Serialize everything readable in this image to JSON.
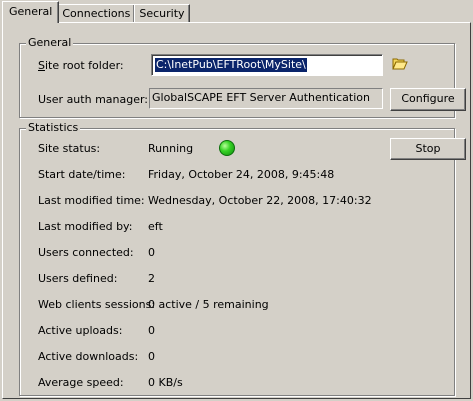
{
  "tabs": [
    {
      "label": "General",
      "active": true
    },
    {
      "label": "Connections",
      "active": false
    },
    {
      "label": "Security",
      "active": false
    }
  ],
  "general": {
    "group_title": "General",
    "site_root_label": "Site root folder:",
    "site_root_value": "C:\\InetPub\\EFTRoot\\MySite\\",
    "user_auth_label": "User auth manager:",
    "user_auth_value": "GlobalSCAPE EFT Server Authentication",
    "configure_button": "Configure",
    "folder_icon": "folder-open-icon"
  },
  "statistics": {
    "group_title": "Statistics",
    "stop_button": "Stop",
    "status_color": "#22c40f",
    "rows": [
      {
        "label": "Site status:",
        "value": "Running"
      },
      {
        "label": "Start date/time:",
        "value": "Friday, October 24, 2008, 9:45:48"
      },
      {
        "label": "Last modified time:",
        "value": "Wednesday, October 22, 2008, 17:40:32"
      },
      {
        "label": "Last modified by:",
        "value": "eft"
      },
      {
        "label": "Users connected:",
        "value": "0"
      },
      {
        "label": "Users defined:",
        "value": "2"
      },
      {
        "label": "Web clients sessions:",
        "value": "0 active / 5 remaining"
      },
      {
        "label": "Active uploads:",
        "value": "0"
      },
      {
        "label": "Active downloads:",
        "value": "0"
      },
      {
        "label": "Average speed:",
        "value": "0 KB/s"
      }
    ]
  }
}
